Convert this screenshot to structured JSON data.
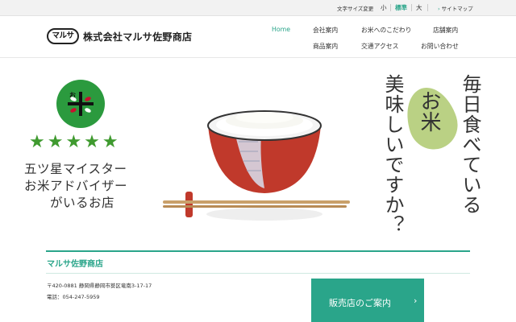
{
  "topbar": {
    "font_size_label": "文字サイズ変更",
    "font_sizes": [
      "小",
      "標準",
      "大"
    ],
    "active_font_size": "標準",
    "sitemap_label": "サイトマップ"
  },
  "header": {
    "logo_mark": "マルサ",
    "company_name": "株式会社マルサ佐野商店",
    "nav": [
      {
        "label": "Home",
        "active": true
      },
      {
        "label": "会社案内",
        "active": false
      },
      {
        "label": "お米へのこだわり",
        "active": false
      },
      {
        "label": "店舗案内",
        "active": false
      },
      {
        "label": "商品案内",
        "active": false
      },
      {
        "label": "交通アクセス",
        "active": false
      },
      {
        "label": "お問い合わせ",
        "active": false
      }
    ]
  },
  "hero": {
    "badge_text": "お米",
    "stars": "★★★★★",
    "star_count": 5,
    "copy_lines": [
      "五ツ星マイスター",
      "お米アドバイザー",
      "がいるお店"
    ],
    "vertical_col1": "毎日食べている",
    "vertical_col2": "美味しいですか？",
    "vertical_highlight": "お米"
  },
  "store": {
    "name": "マルサ佐野商店",
    "address": "〒420-0881 静岡県静岡市葵区竜南3-17-17",
    "tel": "電話：054-247-5959",
    "cta_label": "販売店のご案内",
    "cta_arrow": "›"
  },
  "colors": {
    "accent": "#2aa58a",
    "star": "#3f9a2f",
    "badge": "#2b9a3e",
    "leaf": "#b6cf7d",
    "bowl": "#c0392b"
  }
}
